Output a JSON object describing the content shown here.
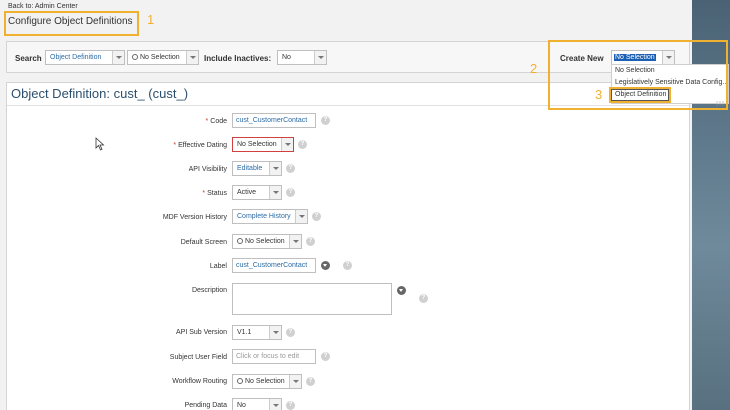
{
  "nav": {
    "back_link": "Back to: Admin Center"
  },
  "page_title": "Configure Object Definitions",
  "callouts": [
    "1",
    "2",
    "3"
  ],
  "toolbar": {
    "search_label": "Search",
    "search_type_value": "Object Definition",
    "search_value": "No Selection",
    "include_inactives_label": "Include Inactives:",
    "include_inactives_value": "No",
    "create_new_label": "Create New",
    "create_new_value": "No Selection",
    "create_new_options": [
      "No Selection",
      "Legislatively Sensitive Data Config...",
      "Object Definition"
    ]
  },
  "form": {
    "title": "Object Definition: cust_ (cust_)",
    "required_marker": "*",
    "fields": {
      "code": {
        "label": "Code",
        "value": "cust_CustomerContact"
      },
      "effective_dating": {
        "label": "Effective Dating",
        "value": "No Selection"
      },
      "api_visibility": {
        "label": "API Visibility",
        "value": "Editable"
      },
      "status": {
        "label": "Status",
        "value": "Active"
      },
      "mdf_version_history": {
        "label": "MDF Version History",
        "value": "Complete History"
      },
      "default_screen": {
        "label": "Default Screen",
        "value": "No Selection"
      },
      "label": {
        "label": "Label",
        "value": "cust_CustomerContact"
      },
      "description": {
        "label": "Description",
        "value": ""
      },
      "api_sub_version": {
        "label": "API Sub Version",
        "value": "V1.1"
      },
      "subject_user_field": {
        "label": "Subject User Field",
        "placeholder": "Click or focus to edit"
      },
      "workflow_routing": {
        "label": "Workflow Routing",
        "value": "No Selection"
      },
      "pending_data": {
        "label": "Pending Data",
        "value": "No"
      }
    }
  },
  "colors": {
    "callout": "#f0b030",
    "link_blue": "#2b6ba6",
    "title_blue": "#2b4f6e",
    "required_red": "#c0392b"
  },
  "icons": [
    "help-icon",
    "translate-icon",
    "chevron-down-icon",
    "search-icon",
    "mouse-pointer-icon"
  ]
}
